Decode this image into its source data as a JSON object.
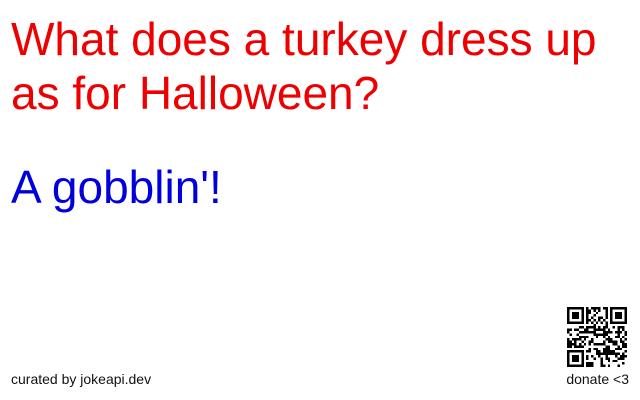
{
  "joke": {
    "setup": "What does a turkey dress up as for Halloween?",
    "delivery": "A gobblin'!"
  },
  "footer": {
    "credit": "curated by jokeapi.dev",
    "donate": "donate <3"
  },
  "colors": {
    "setup": "#ee0000",
    "delivery": "#0000dd",
    "text": "#111111",
    "background": "#ffffff"
  },
  "icons": {
    "qr": "qr-code-icon"
  }
}
